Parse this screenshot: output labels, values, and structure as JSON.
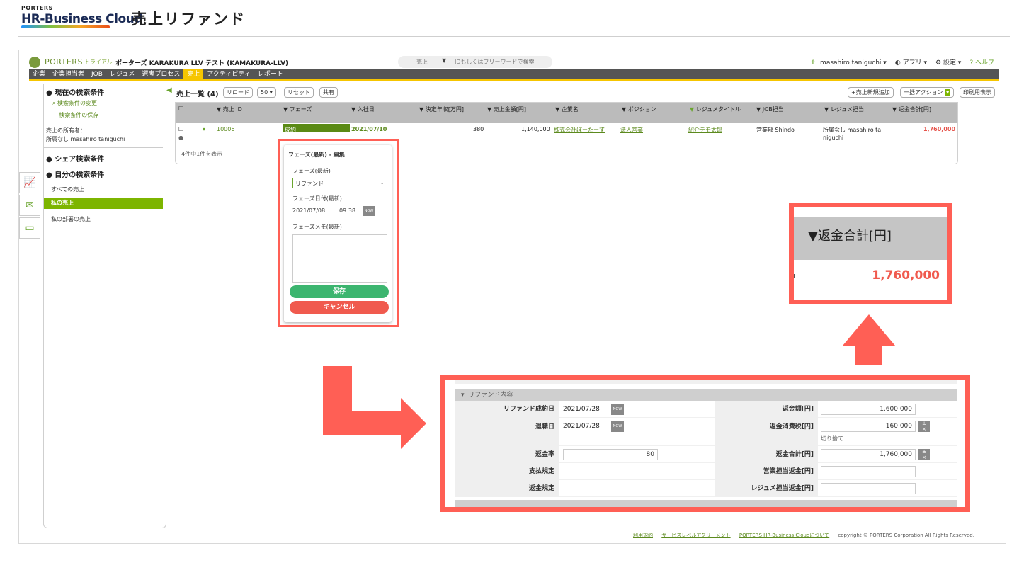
{
  "doc": {
    "logo_small": "PORTERS",
    "logo_big": "HR-Business Cloud",
    "title": "売上リファンド"
  },
  "app": {
    "brand": "PORTERS",
    "trial": "トライアル",
    "company": "ポーターズ KARAKURA LLV テスト (KAMAKURA-LLV)",
    "search_scope": "売上",
    "search_placeholder": "IDもしくはフリーワードで検索",
    "user": "masahiro taniguchi",
    "apps": "アプリ",
    "settings": "設定",
    "help": "ヘルプ",
    "nav": [
      "企業",
      "企業担当者",
      "JOB",
      "レジュメ",
      "選考プロセス",
      "売上",
      "アクティビティ",
      "レポート"
    ],
    "nav_active_index": 5
  },
  "sidebar": {
    "current_conditions": "現在の検索条件",
    "change_conditions": "検索条件の変更",
    "save_conditions": "検索条件の保存",
    "owner_label": "売上の所有者：",
    "owner_value": "所属なし masahiro taniguchi",
    "shared_conditions": "シェア検索条件",
    "my_conditions": "自分の検索条件",
    "items": [
      "すべての売上",
      "私の売上",
      "私の部署の売上"
    ],
    "active_item_index": 1
  },
  "list": {
    "title": "売上一覧 (4)",
    "reload": "リロード",
    "per_page": "50",
    "reset": "リセット",
    "share": "共有",
    "new_button": "+売上新規追加",
    "bulk_action": "一括アクション",
    "print": "印刷用表示",
    "columns": [
      "売上 ID",
      "フェーズ",
      "入社日",
      "決定年収[万円]",
      "売上金額[円]",
      "企業名",
      "ポジション",
      "レジュメタイトル",
      "JOB担当",
      "レジュメ担当",
      "返金合計[円]"
    ],
    "row": {
      "id": "10006",
      "phase": "成約",
      "join_date": "2021/07/10",
      "annual_income": "380",
      "sales_amount": "1,140,000",
      "company": "株式会社ぽーたーず",
      "position": "法人営業",
      "resume_title": "紹介デモ太郎",
      "job_owner": "営業部 Shindo",
      "resume_owner_line1": "所属なし masahiro ta",
      "resume_owner_line2": "niguchi",
      "refund_total": "1,760,000"
    },
    "count_text": "4件中1件を表示"
  },
  "phase_popup": {
    "title": "フェーズ(最新) - 編集",
    "phase_label": "フェーズ(最新)",
    "phase_value": "リファンド",
    "date_label": "フェーズ日付(最新)",
    "date_value": "2021/07/08",
    "time_value": "09:38",
    "now": "NOW",
    "memo_label": "フェーズメモ(最新)",
    "save": "保存",
    "cancel": "キャンセル"
  },
  "zoom": {
    "header": "▼返金合計[円]",
    "value": "1,760,000"
  },
  "refund": {
    "section_title": "リファンド内容",
    "refund_date_label": "リファンド成約日",
    "refund_date": "2021/07/28",
    "retire_date_label": "退職日",
    "retire_date": "2021/07/28",
    "refund_rate_label": "返金率",
    "refund_rate": "80",
    "payment_rule_label": "支払規定",
    "refund_rule_label": "返金規定",
    "refund_amount_label": "返金額[円]",
    "refund_amount": "1,600,000",
    "refund_tax_label": "返金消費税[円]",
    "refund_tax": "160,000",
    "rounding": "切り捨て",
    "refund_total_label": "返金合計[円]",
    "refund_total": "1,760,000",
    "sales_refund_label": "営業担当返金[円]",
    "resume_refund_label": "レジュメ担当返金[円]",
    "now": "NOW"
  },
  "footer": {
    "terms": "利用規約",
    "sla": "サービスレベルアグリーメント",
    "about": "PORTERS HR-Business Cloudについて",
    "copyright": "copyright © PORTERS Corporation All Rights Reserved."
  },
  "colors": {
    "highlight": "#ff5f55",
    "accent_green": "#7db500",
    "nav_yellow": "#f6c500",
    "refund_red": "#f05a4e"
  }
}
